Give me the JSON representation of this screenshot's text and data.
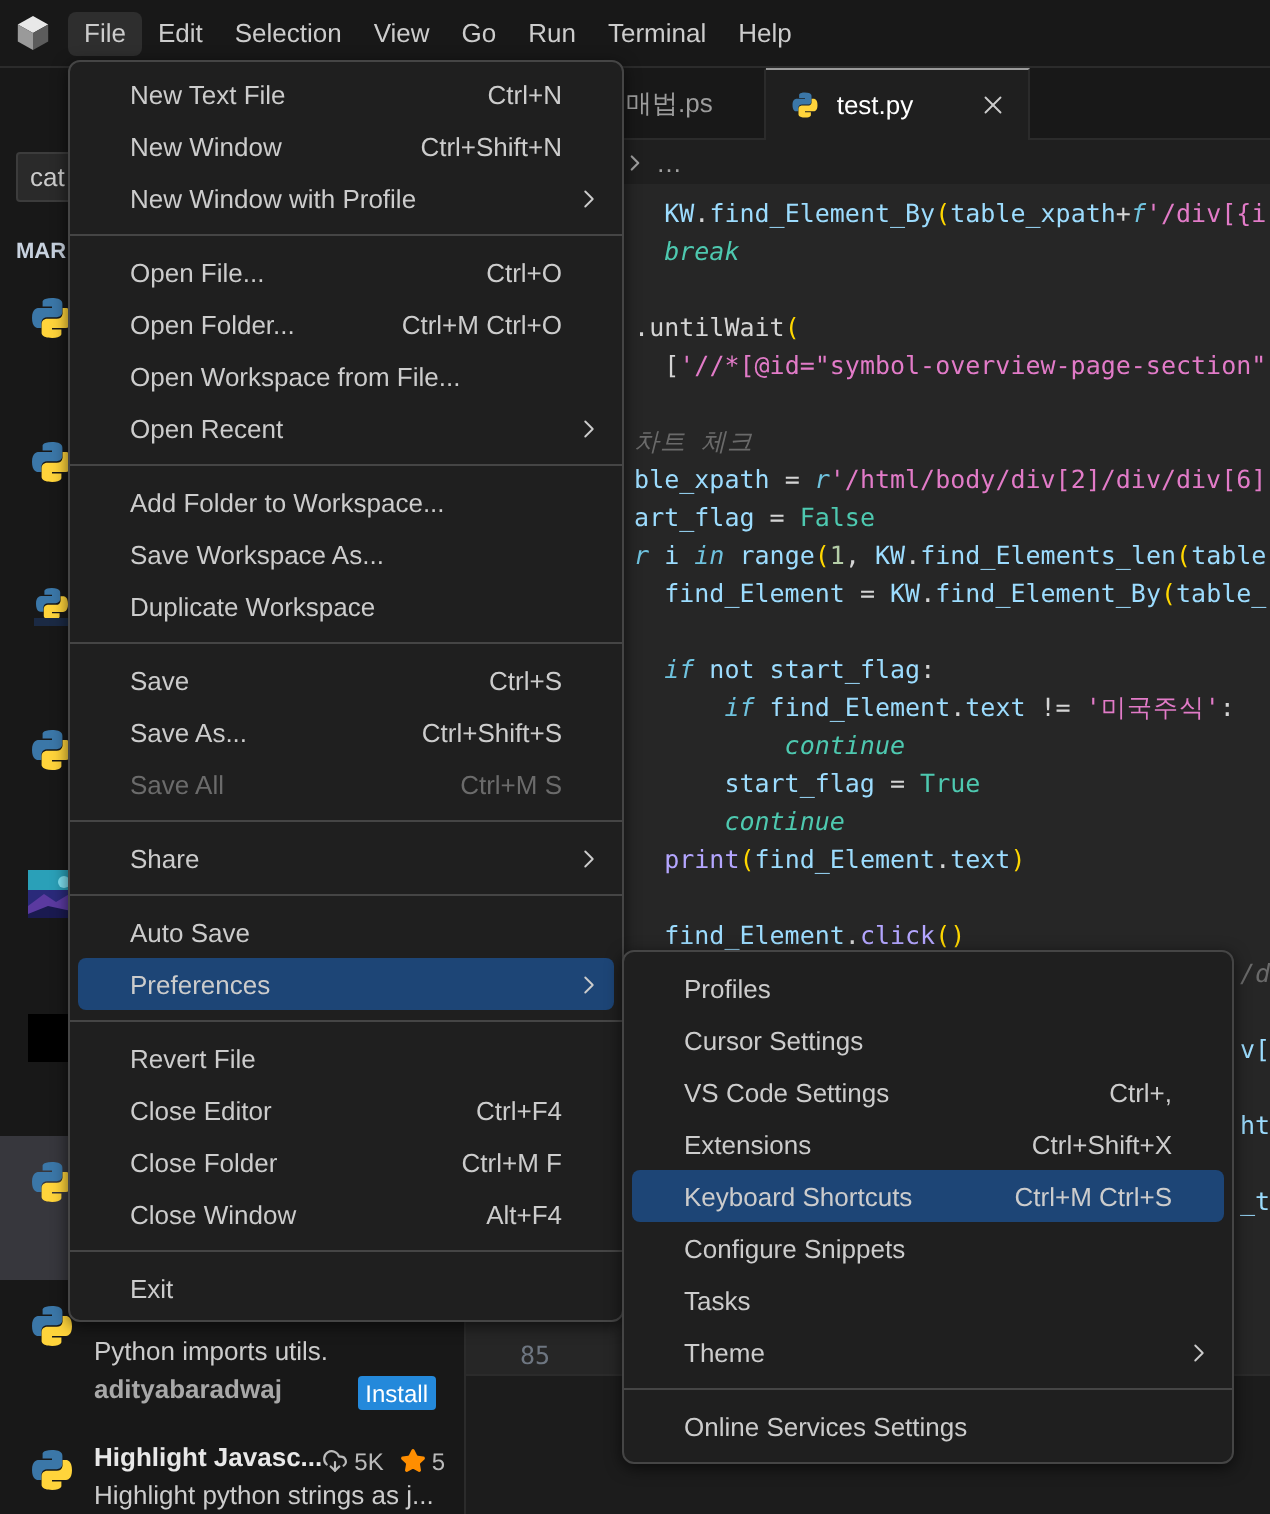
{
  "menubar": {
    "items": [
      {
        "label": "File",
        "selected": true
      },
      {
        "label": "Edit",
        "selected": false
      },
      {
        "label": "Selection",
        "selected": false
      },
      {
        "label": "View",
        "selected": false
      },
      {
        "label": "Go",
        "selected": false
      },
      {
        "label": "Run",
        "selected": false
      },
      {
        "label": "Terminal",
        "selected": false
      },
      {
        "label": "Help",
        "selected": false
      }
    ]
  },
  "sidebar": {
    "search": {
      "value": "cat"
    },
    "section_header": "MAR",
    "extensions": [
      {
        "kind": "python",
        "selected": false
      },
      {
        "kind": "python",
        "selected": false
      },
      {
        "kind": "python-label",
        "selected": false
      },
      {
        "kind": "python",
        "selected": false
      },
      {
        "kind": "picture",
        "selected": false
      },
      {
        "kind": "dark",
        "selected": false
      },
      {
        "kind": "python",
        "selected": true
      },
      {
        "kind": "python",
        "selected": false,
        "description": "Python imports utils.",
        "publisher": "adityabaradwaj",
        "action": "Install"
      },
      {
        "kind": "python",
        "selected": false,
        "title": "Highlight Javasc...",
        "downloads": "5K",
        "rating": "5",
        "description": "Highlight python strings as j..."
      }
    ]
  },
  "editor": {
    "tabs": [
      {
        "kind": "plain",
        "label": "매법.ps",
        "selected": false
      },
      {
        "kind": "python",
        "label": "test.py",
        "selected": true
      }
    ],
    "breadcrumb": "…",
    "line_numbers": [
      "85"
    ],
    "code_lines": [
      {
        "kind": "code",
        "tokens": [
          {
            "text": "    KW",
            "kind": "variable"
          },
          {
            "text": ".",
            "kind": "plain"
          },
          {
            "text": "find_Element_By",
            "kind": "variable"
          },
          {
            "text": "(",
            "kind": "paren"
          },
          {
            "text": "table_xpath",
            "kind": "variable"
          },
          {
            "text": "+",
            "kind": "plain"
          },
          {
            "text": "f",
            "kind": "keyword"
          },
          {
            "text": "'/div[{i",
            "kind": "string"
          }
        ]
      },
      {
        "kind": "code",
        "tokens": [
          {
            "text": "    break",
            "kind": "control"
          }
        ]
      },
      {
        "kind": "blank"
      },
      {
        "kind": "code",
        "tokens": [
          {
            "text": "  .untilWait",
            "kind": "plain"
          },
          {
            "text": "(",
            "kind": "paren"
          }
        ]
      },
      {
        "kind": "code",
        "tokens": [
          {
            "text": "    [",
            "kind": "plain"
          },
          {
            "text": "'//*[@id=\"symbol-overview-page-section\"",
            "kind": "string"
          }
        ]
      },
      {
        "kind": "blank"
      },
      {
        "kind": "code",
        "tokens": [
          {
            "text": "  차트 체크",
            "kind": "comment"
          }
        ]
      },
      {
        "kind": "code",
        "tokens": [
          {
            "text": "  ble_xpath",
            "kind": "variable"
          },
          {
            "text": " = ",
            "kind": "plain"
          },
          {
            "text": "r",
            "kind": "keyword"
          },
          {
            "text": "'/html/body/div[2]/div/div[6]",
            "kind": "string"
          }
        ]
      },
      {
        "kind": "code",
        "tokens": [
          {
            "text": "  art_flag",
            "kind": "variable"
          },
          {
            "text": " = ",
            "kind": "plain"
          },
          {
            "text": "False",
            "kind": "constant"
          }
        ]
      },
      {
        "kind": "code",
        "tokens": [
          {
            "text": "  r",
            "kind": "keyword"
          },
          {
            "text": " i ",
            "kind": "variable"
          },
          {
            "text": "in",
            "kind": "keyword"
          },
          {
            "text": " range",
            "kind": "variable"
          },
          {
            "text": "(",
            "kind": "paren"
          },
          {
            "text": "1",
            "kind": "number"
          },
          {
            "text": ", ",
            "kind": "plain"
          },
          {
            "text": "KW",
            "kind": "variable"
          },
          {
            "text": ".",
            "kind": "plain"
          },
          {
            "text": "find_Elements_len",
            "kind": "variable"
          },
          {
            "text": "(",
            "kind": "paren"
          },
          {
            "text": "table",
            "kind": "variable"
          }
        ]
      },
      {
        "kind": "code",
        "tokens": [
          {
            "text": "    find_Element",
            "kind": "variable"
          },
          {
            "text": " = ",
            "kind": "plain"
          },
          {
            "text": "KW",
            "kind": "variable"
          },
          {
            "text": ".",
            "kind": "plain"
          },
          {
            "text": "find_Element_By",
            "kind": "variable"
          },
          {
            "text": "(",
            "kind": "paren"
          },
          {
            "text": "table_",
            "kind": "variable"
          }
        ]
      },
      {
        "kind": "blank"
      },
      {
        "kind": "code",
        "tokens": [
          {
            "text": "    if",
            "kind": "keyword"
          },
          {
            "text": " not ",
            "kind": "variable"
          },
          {
            "text": "start_flag",
            "kind": "variable"
          },
          {
            "text": ":",
            "kind": "plain"
          }
        ]
      },
      {
        "kind": "code",
        "tokens": [
          {
            "text": "        if",
            "kind": "keyword"
          },
          {
            "text": " find_Element",
            "kind": "variable"
          },
          {
            "text": ".",
            "kind": "plain"
          },
          {
            "text": "text",
            "kind": "variable"
          },
          {
            "text": " != ",
            "kind": "plain"
          },
          {
            "text": "'미국주식'",
            "kind": "string"
          },
          {
            "text": ":",
            "kind": "plain"
          }
        ]
      },
      {
        "kind": "code",
        "tokens": [
          {
            "text": "            continue",
            "kind": "control"
          }
        ]
      },
      {
        "kind": "code",
        "tokens": [
          {
            "text": "        start_flag",
            "kind": "variable"
          },
          {
            "text": " = ",
            "kind": "plain"
          },
          {
            "text": "True",
            "kind": "constant"
          }
        ]
      },
      {
        "kind": "code",
        "tokens": [
          {
            "text": "        continue",
            "kind": "control"
          }
        ]
      },
      {
        "kind": "code",
        "tokens": [
          {
            "text": "    print",
            "kind": "builtin"
          },
          {
            "text": "(",
            "kind": "paren"
          },
          {
            "text": "find_Element",
            "kind": "variable"
          },
          {
            "text": ".",
            "kind": "plain"
          },
          {
            "text": "text",
            "kind": "variable"
          },
          {
            "text": ")",
            "kind": "paren"
          }
        ]
      },
      {
        "kind": "blank"
      },
      {
        "kind": "code",
        "tokens": [
          {
            "text": "    find_Element",
            "kind": "variable"
          },
          {
            "text": ".",
            "kind": "plain"
          },
          {
            "text": "click",
            "kind": "builtin"
          },
          {
            "text": "()",
            "kind": "paren"
          }
        ]
      },
      {
        "kind": "tail",
        "tokens": [
          {
            "text": "/d",
            "kind": "comment"
          }
        ]
      },
      {
        "kind": "blank"
      },
      {
        "kind": "tail",
        "tokens": [
          {
            "text": "v[",
            "kind": "variable"
          }
        ]
      },
      {
        "kind": "blank"
      },
      {
        "kind": "tail",
        "tokens": [
          {
            "text": "ht",
            "kind": "variable"
          }
        ]
      },
      {
        "kind": "blank"
      },
      {
        "kind": "tail",
        "tokens": [
          {
            "text": "_t",
            "kind": "variable"
          }
        ]
      }
    ]
  },
  "file_menu": {
    "items": [
      {
        "kind": "item",
        "label": "New Text File",
        "shortcut": "Ctrl+N",
        "submenu": false,
        "disabled": false,
        "selected": false
      },
      {
        "kind": "item",
        "label": "New Window",
        "shortcut": "Ctrl+Shift+N",
        "submenu": false,
        "disabled": false,
        "selected": false
      },
      {
        "kind": "item",
        "label": "New Window with Profile",
        "submenu": true,
        "disabled": false,
        "selected": false
      },
      {
        "kind": "separator"
      },
      {
        "kind": "item",
        "label": "Open File...",
        "shortcut": "Ctrl+O",
        "submenu": false,
        "disabled": false,
        "selected": false
      },
      {
        "kind": "item",
        "label": "Open Folder...",
        "shortcut": "Ctrl+M Ctrl+O",
        "submenu": false,
        "disabled": false,
        "selected": false
      },
      {
        "kind": "item",
        "label": "Open Workspace from File...",
        "submenu": false,
        "disabled": false,
        "selected": false
      },
      {
        "kind": "item",
        "label": "Open Recent",
        "submenu": true,
        "disabled": false,
        "selected": false
      },
      {
        "kind": "separator"
      },
      {
        "kind": "item",
        "label": "Add Folder to Workspace...",
        "submenu": false,
        "disabled": false,
        "selected": false
      },
      {
        "kind": "item",
        "label": "Save Workspace As...",
        "submenu": false,
        "disabled": false,
        "selected": false
      },
      {
        "kind": "item",
        "label": "Duplicate Workspace",
        "submenu": false,
        "disabled": false,
        "selected": false
      },
      {
        "kind": "separator"
      },
      {
        "kind": "item",
        "label": "Save",
        "shortcut": "Ctrl+S",
        "submenu": false,
        "disabled": false,
        "selected": false
      },
      {
        "kind": "item",
        "label": "Save As...",
        "shortcut": "Ctrl+Shift+S",
        "submenu": false,
        "disabled": false,
        "selected": false
      },
      {
        "kind": "item",
        "label": "Save All",
        "shortcut": "Ctrl+M S",
        "submenu": false,
        "disabled": true,
        "selected": false
      },
      {
        "kind": "separator"
      },
      {
        "kind": "item",
        "label": "Share",
        "submenu": true,
        "disabled": false,
        "selected": false
      },
      {
        "kind": "separator"
      },
      {
        "kind": "item",
        "label": "Auto Save",
        "submenu": false,
        "disabled": false,
        "selected": false
      },
      {
        "kind": "item",
        "label": "Preferences",
        "submenu": true,
        "disabled": false,
        "selected": true
      },
      {
        "kind": "separator"
      },
      {
        "kind": "item",
        "label": "Revert File",
        "submenu": false,
        "disabled": false,
        "selected": false
      },
      {
        "kind": "item",
        "label": "Close Editor",
        "shortcut": "Ctrl+F4",
        "submenu": false,
        "disabled": false,
        "selected": false
      },
      {
        "kind": "item",
        "label": "Close Folder",
        "shortcut": "Ctrl+M F",
        "submenu": false,
        "disabled": false,
        "selected": false
      },
      {
        "kind": "item",
        "label": "Close Window",
        "shortcut": "Alt+F4",
        "submenu": false,
        "disabled": false,
        "selected": false
      },
      {
        "kind": "separator"
      },
      {
        "kind": "item",
        "label": "Exit",
        "submenu": false,
        "disabled": false,
        "selected": false
      }
    ]
  },
  "preferences_menu": {
    "items": [
      {
        "kind": "item",
        "label": "Profiles",
        "submenu": false,
        "disabled": false,
        "selected": false
      },
      {
        "kind": "item",
        "label": "Cursor Settings",
        "submenu": false,
        "disabled": false,
        "selected": false
      },
      {
        "kind": "item",
        "label": "VS Code Settings",
        "shortcut": "Ctrl+,",
        "submenu": false,
        "disabled": false,
        "selected": false
      },
      {
        "kind": "item",
        "label": "Extensions",
        "shortcut": "Ctrl+Shift+X",
        "submenu": false,
        "disabled": false,
        "selected": false
      },
      {
        "kind": "item",
        "label": "Keyboard Shortcuts",
        "shortcut": "Ctrl+M Ctrl+S",
        "submenu": false,
        "disabled": false,
        "selected": true
      },
      {
        "kind": "item",
        "label": "Configure Snippets",
        "submenu": false,
        "disabled": false,
        "selected": false
      },
      {
        "kind": "item",
        "label": "Tasks",
        "submenu": false,
        "disabled": false,
        "selected": false
      },
      {
        "kind": "item",
        "label": "Theme",
        "submenu": true,
        "disabled": false,
        "selected": false
      },
      {
        "kind": "separator"
      },
      {
        "kind": "item",
        "label": "Online Services Settings",
        "submenu": false,
        "disabled": false,
        "selected": false
      }
    ]
  }
}
